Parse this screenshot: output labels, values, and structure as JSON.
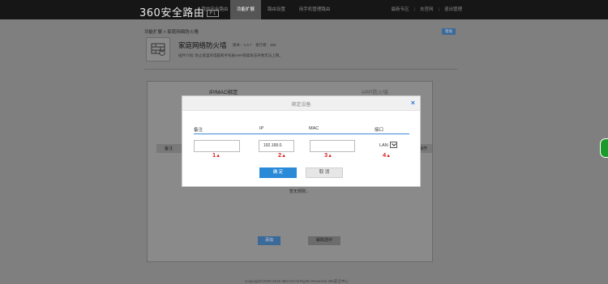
{
  "topbar": {
    "logo": "360安全路由",
    "logo_badge": "P1",
    "nav": [
      "我的安全路由",
      "功能扩展",
      "路由设置",
      "用手机管理路由"
    ],
    "right": [
      "最新专区",
      "去官网",
      "退出管理"
    ]
  },
  "breadcrumb": "功能扩展 > 家庭网络防火墙",
  "help_label": "帮助",
  "app": {
    "title": "家庭网络防火墙",
    "meta": "版本：1.0.7　发行者：360",
    "desc": "插件介绍: 防止家里的电脑和手机被ARP病毒攻击导致无法上网。"
  },
  "card": {
    "tabs": [
      "IP/MAC绑定",
      "ARP防火墙"
    ],
    "table_headers": [
      "备注",
      "操作"
    ],
    "empty_text": "暂无规则...",
    "buttons": [
      "添加",
      "解除选中"
    ]
  },
  "footer": "Copyright©2005-2016 360.CN All Rights Reserved  360安全中心",
  "modal": {
    "title": "绑定设备",
    "columns": [
      "备注",
      "IP",
      "MAC",
      "接口"
    ],
    "fields": {
      "note": "",
      "ip": "192.168.0.",
      "mac": "",
      "port": "LAN"
    },
    "markers": [
      "1",
      "2",
      "3",
      "4"
    ],
    "marker_symbol": "▲",
    "ok_label": "确 定",
    "cancel_label": "取 消"
  },
  "colors": {
    "accent_blue": "#2a8ad8",
    "marker_red": "#e02020",
    "side_tab_green": "#1a9a2a"
  }
}
